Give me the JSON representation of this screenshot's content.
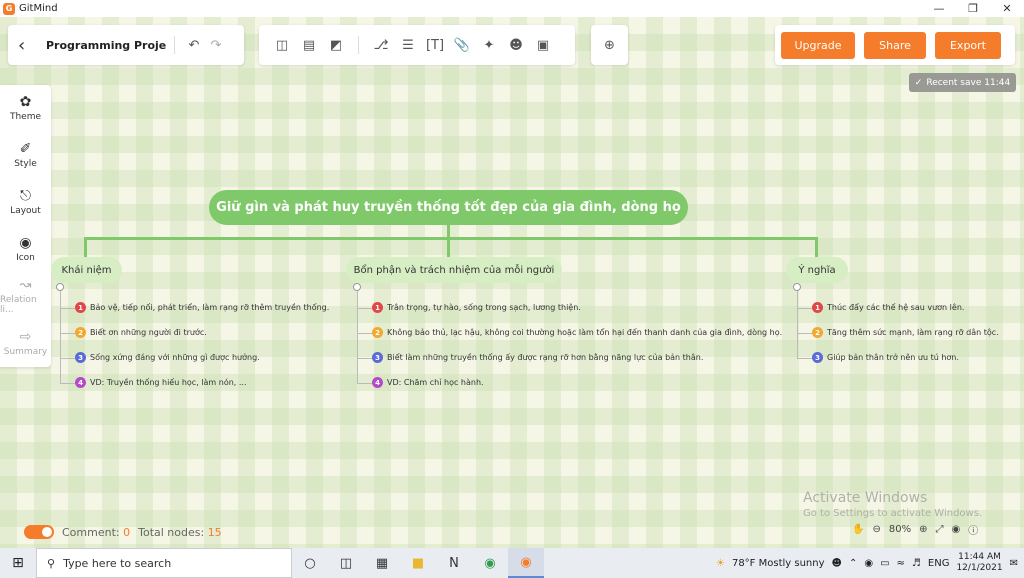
{
  "window": {
    "app_name": "GitMind"
  },
  "toolbar": {
    "doc_title": "Programming Proje...",
    "upgrade": "Upgrade",
    "share": "Share",
    "export": "Export"
  },
  "recent_save": "Recent save 11:44",
  "sidebar": {
    "items": [
      {
        "label": "Theme",
        "icon": "theme-icon"
      },
      {
        "label": "Style",
        "icon": "style-icon"
      },
      {
        "label": "Layout",
        "icon": "layout-icon"
      },
      {
        "label": "Icon",
        "icon": "icon-icon"
      },
      {
        "label": "Relation li...",
        "icon": "relation-icon"
      },
      {
        "label": "Summary",
        "icon": "summary-icon"
      }
    ]
  },
  "mindmap": {
    "root": "Giữ gìn và phát huy truyền thống tốt đẹp của gia đình, dòng họ",
    "branches": [
      {
        "title": "Khái niệm",
        "leaves": [
          {
            "n": "1",
            "text": "Bảo vệ, tiếp nối, phát triển, làm rạng rỡ thêm truyền thống."
          },
          {
            "n": "2",
            "text": "Biết ơn những người đi trước."
          },
          {
            "n": "3",
            "text": "Sống xứng đáng với những gì được hưởng."
          },
          {
            "n": "4",
            "text": "VD: Truyền thống hiếu học, làm nón, ..."
          }
        ]
      },
      {
        "title": "Bổn phận và trách nhiệm của mỗi người",
        "leaves": [
          {
            "n": "1",
            "text": "Trân trọng, tự hào, sống trong sạch, lương thiện."
          },
          {
            "n": "2",
            "text": "Không bảo thủ, lạc hậu, không coi thường hoặc làm tổn hại đến thanh danh của gia đình, dòng họ."
          },
          {
            "n": "3",
            "text": "Biết làm những truyền thống ấy được rạng rỡ hơn bằng năng lực của bản thân."
          },
          {
            "n": "4",
            "text": "VD: Chăm chỉ học hành."
          }
        ]
      },
      {
        "title": "Ý nghĩa",
        "leaves": [
          {
            "n": "1",
            "text": "Thúc đẩy các thế hệ sau vươn lên."
          },
          {
            "n": "2",
            "text": "Tăng thêm sức mạnh, làm rạng rỡ dân tộc."
          },
          {
            "n": "3",
            "text": "Giúp bản thân trở nên ưu tú hơn."
          }
        ]
      }
    ],
    "num_colors": [
      "#e04848",
      "#f0a830",
      "#5a6ad8",
      "#b54ac8"
    ]
  },
  "status": {
    "comment_label": "Comment:",
    "comment_count": "0",
    "nodes_label": "Total nodes:",
    "nodes_count": "15",
    "zoom": "80%"
  },
  "watermark": {
    "line1": "Activate Windows",
    "line2": "Go to Settings to activate Windows."
  },
  "taskbar": {
    "search_placeholder": "Type here to search",
    "weather": "78°F  Mostly sunny",
    "lang": "ENG",
    "time": "11:44 AM",
    "date": "12/1/2021"
  }
}
